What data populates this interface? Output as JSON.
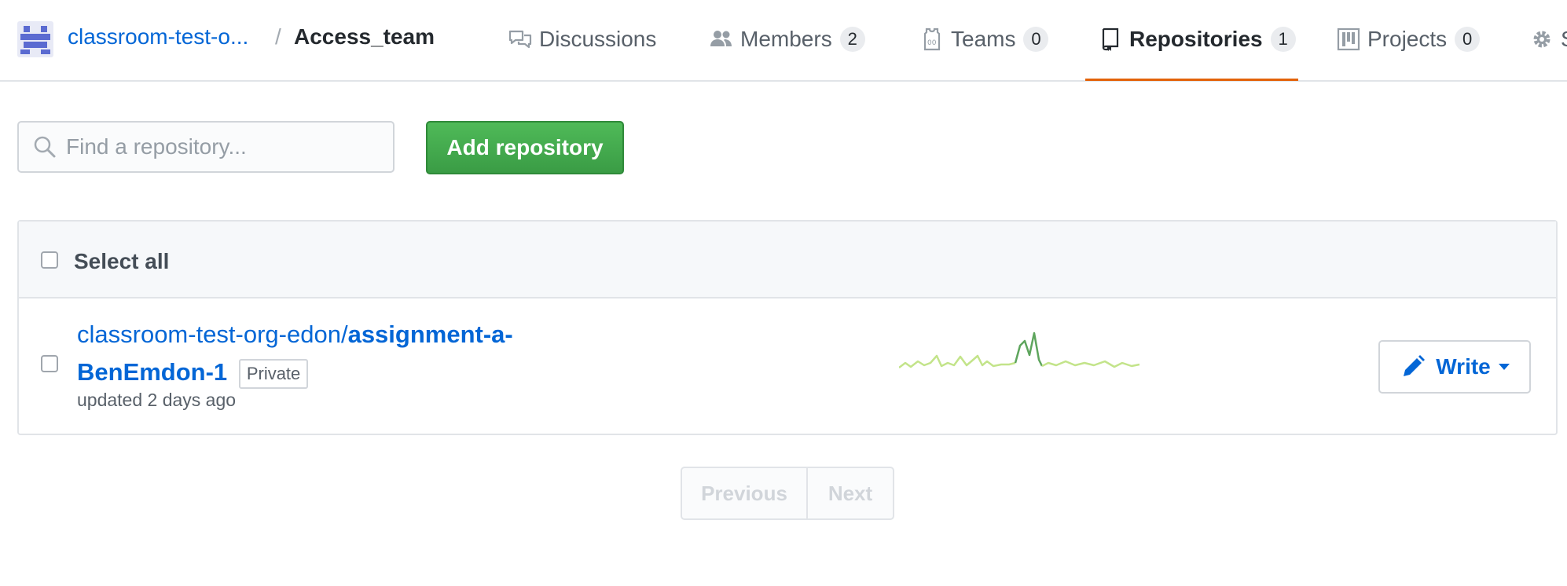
{
  "header": {
    "org_name": "classroom-test-o...",
    "separator": "/",
    "team_name": "Access_team",
    "tabs": [
      {
        "label": "Discussions",
        "icon": "comment-discussion-icon",
        "count": null
      },
      {
        "label": "Members",
        "icon": "people-icon",
        "count": "2"
      },
      {
        "label": "Teams",
        "icon": "jersey-icon",
        "count": "0"
      },
      {
        "label": "Repositories",
        "icon": "repo-icon",
        "count": "1",
        "selected": true
      },
      {
        "label": "Projects",
        "icon": "project-icon",
        "count": "0"
      },
      {
        "label": "S",
        "icon": "gear-icon",
        "count": null
      }
    ]
  },
  "toolbar": {
    "search_placeholder": "Find a repository...",
    "add_button": "Add repository"
  },
  "table": {
    "select_all": "Select all",
    "rows": [
      {
        "owner": "classroom-test-org-edon/",
        "repo": "assignment-a-BenEmdon-1",
        "visibility": "Private",
        "updated": "updated 2 days ago",
        "permission": "Write"
      }
    ]
  },
  "pagination": {
    "previous": "Previous",
    "next": "Next"
  },
  "colors": {
    "link": "#0366d6",
    "primary_button": "#3a9c45",
    "selected_tab_underline": "#e36209",
    "sparkline_light": "#c3e48a",
    "sparkline_dark": "#5ea55d"
  }
}
